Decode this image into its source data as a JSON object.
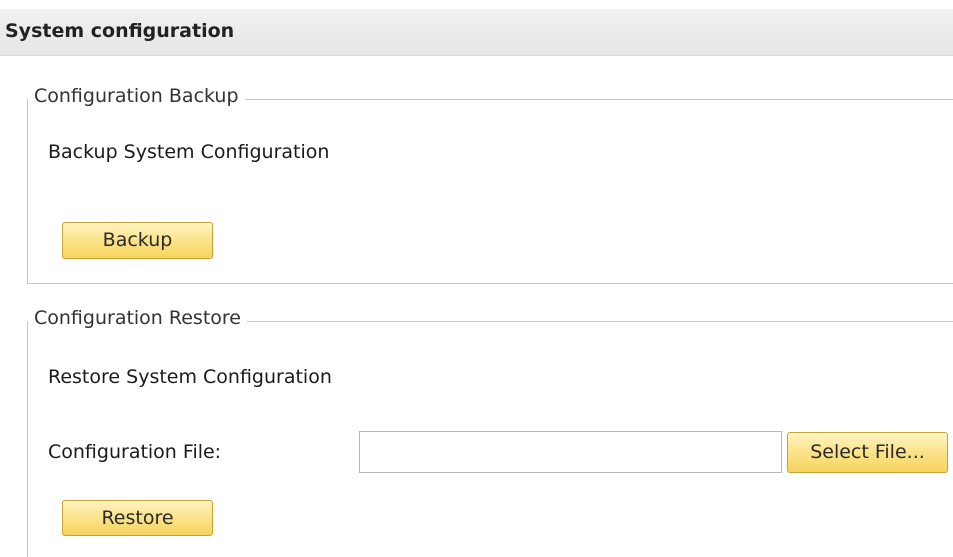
{
  "header": {
    "title": "System configuration"
  },
  "backup_section": {
    "legend": "Configuration Backup",
    "description": "Backup System Configuration",
    "button_label": "Backup"
  },
  "restore_section": {
    "legend": "Configuration Restore",
    "description": "Restore System Configuration",
    "file_label": "Configuration File:",
    "file_value": "",
    "select_button_label": "Select File...",
    "restore_button_label": "Restore"
  },
  "colors": {
    "header_bg": "#e9e9e9",
    "button_bg": "#fbe38a",
    "button_border": "#c9a338",
    "fieldset_border": "#c8c8c8"
  }
}
